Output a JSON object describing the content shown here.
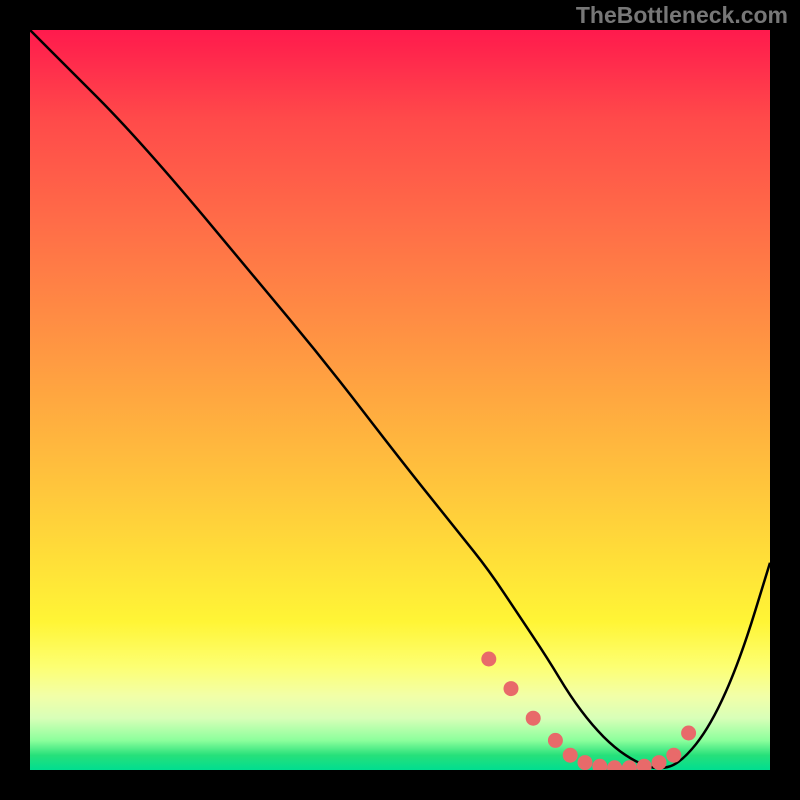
{
  "watermark": "TheBottleneck.com",
  "chart_data": {
    "type": "line",
    "title": "",
    "xlabel": "",
    "ylabel": "",
    "xlim": [
      0,
      100
    ],
    "ylim": [
      0,
      100
    ],
    "series": [
      {
        "name": "bottleneck-curve",
        "color": "#000000",
        "x": [
          0,
          6,
          12,
          20,
          30,
          40,
          50,
          58,
          62,
          66,
          70,
          73,
          76,
          79,
          82,
          85,
          88,
          92,
          96,
          100
        ],
        "y": [
          100,
          94,
          88,
          79,
          67,
          55,
          42,
          32,
          27,
          21,
          15,
          10,
          6,
          3,
          1,
          0,
          1,
          6,
          15,
          28
        ]
      },
      {
        "name": "scatter-markers",
        "color": "#e86a6a",
        "type": "scatter",
        "x": [
          62,
          65,
          68,
          71,
          73,
          75,
          77,
          79,
          81,
          83,
          85,
          87,
          89
        ],
        "y": [
          15,
          11,
          7,
          4,
          2,
          1,
          0.5,
          0.3,
          0.3,
          0.5,
          1,
          2,
          5
        ]
      }
    ],
    "gradient_stops": [
      {
        "pos": 0,
        "color": "#ff1a4d"
      },
      {
        "pos": 50,
        "color": "#ffa840"
      },
      {
        "pos": 80,
        "color": "#fff536"
      },
      {
        "pos": 100,
        "color": "#00de90"
      }
    ]
  }
}
